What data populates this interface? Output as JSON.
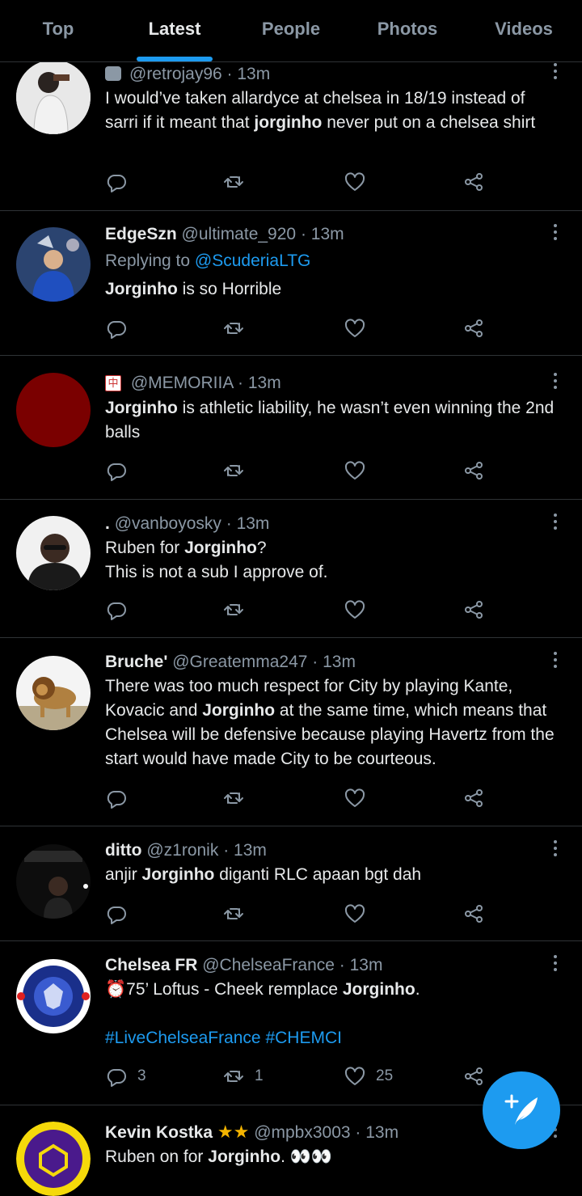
{
  "tabs": [
    {
      "label": "Top"
    },
    {
      "label": "Latest",
      "active": true
    },
    {
      "label": "People"
    },
    {
      "label": "Photos"
    },
    {
      "label": "Videos"
    }
  ],
  "tweets": [
    {
      "handle": "@retrojay96",
      "time": "· 13m",
      "text_parts": [
        "I would’ve taken allardyce at chelsea in 18/19 instead of sarri if it meant that ",
        "jorginho",
        " never put on a chelsea shirt"
      ]
    },
    {
      "name": "EdgeSzn",
      "handle": "@ultimate_920",
      "time": "· 13m",
      "reply_prefix": "Replying to ",
      "reply_to": "@ScuderiaLTG",
      "text_parts": [
        "Jorginho",
        " is so Horrible"
      ]
    },
    {
      "name_icon": "中",
      "handle": "@MEMORIIA",
      "time": "· 13m",
      "text_parts": [
        "Jorginho",
        " is athletic liability, he wasn’t even winning the 2nd balls"
      ]
    },
    {
      "name": ".",
      "handle": "@vanboyosky",
      "time": "· 13m",
      "text_parts": [
        "Ruben for ",
        "Jorginho",
        "?"
      ],
      "text_line2": "This is not a sub I approve of."
    },
    {
      "name": "Bruche'",
      "handle": "@Greatemma247",
      "time": "· 13m",
      "text_parts": [
        "There was too much respect for City by playing Kante, Kovacic and ",
        "Jorginho",
        " at the same time, which means that Chelsea will be defensive because playing Havertz from the start would have made City to be courteous."
      ]
    },
    {
      "name": "ditto",
      "handle": "@z1ronik",
      "time": "· 13m",
      "text_parts": [
        "anjir ",
        "Jorginho",
        " diganti RLC apaan bgt dah"
      ]
    },
    {
      "name": "Chelsea FR",
      "handle": "@ChelseaFrance",
      "time": "· 13m",
      "text_parts": [
        "75’ Loftus - Cheek remplace ",
        "Jorginho",
        "."
      ],
      "hashtags": "#LiveChelseaFrance #CHEMCI",
      "replies": "3",
      "retweets": "1",
      "likes": "25"
    },
    {
      "name": "Kevin Kostka",
      "handle": "@mpbx3003",
      "time": "· 13m",
      "text_parts": [
        "Ruben on for ",
        "Jorginho",
        ". "
      ]
    }
  ],
  "icons": {
    "reply": "reply-icon",
    "retweet": "retweet-icon",
    "like": "heart-icon",
    "share": "share-icon",
    "compose": "compose-tweet-icon"
  },
  "colors": {
    "accent": "#1d9bf0",
    "background": "#000000",
    "muted": "#8b98a5"
  }
}
